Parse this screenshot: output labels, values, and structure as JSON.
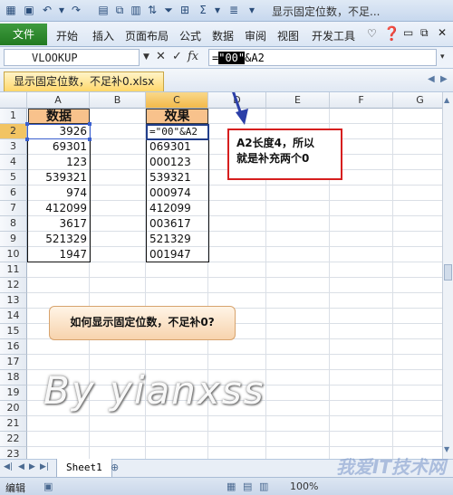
{
  "title_bar": {
    "title": "显示固定位数，不足..."
  },
  "ribbon": {
    "file": "文件",
    "tabs": [
      "开始",
      "插入",
      "页面布局",
      "公式",
      "数据",
      "审阅",
      "视图",
      "开发工具"
    ]
  },
  "formula_bar": {
    "name_box": "VLOOKUP",
    "formula_prefix": "=",
    "formula_highlight": "\"00\"",
    "formula_rest": "&A2"
  },
  "workbook_tab": "显示固定位数，不足补0.xlsx",
  "columns": [
    "A",
    "B",
    "C",
    "D",
    "E",
    "F",
    "G"
  ],
  "rows": [
    "1",
    "2",
    "3",
    "4",
    "5",
    "6",
    "7",
    "8",
    "9",
    "10",
    "11",
    "12",
    "13",
    "14",
    "15",
    "16",
    "17",
    "18",
    "19",
    "20",
    "21",
    "22",
    "23"
  ],
  "column_a": {
    "header": "数据",
    "values": [
      "3926",
      "69301",
      "123",
      "539321",
      "974",
      "412099",
      "3617",
      "521329",
      "1947"
    ]
  },
  "column_c": {
    "header": "效果",
    "values": [
      "=\"00\"&A2",
      "069301",
      "000123",
      "539321",
      "000974",
      "412099",
      "003617",
      "521329",
      "001947"
    ]
  },
  "note": {
    "line1": "A2长度4，所以",
    "line2": "就是补充两个0"
  },
  "question": "如何显示固定位数，不足补0?",
  "watermark": "By yianxss",
  "sheet_tab": "Sheet1",
  "status": {
    "mode": "编辑",
    "zoom": "100%"
  },
  "site_mark": "我爱IT技术网",
  "colors": {
    "excel_green": "#217a21",
    "header_fill": "#f8c28c",
    "note_border": "#d61e1e",
    "selection": "#223e8a"
  }
}
